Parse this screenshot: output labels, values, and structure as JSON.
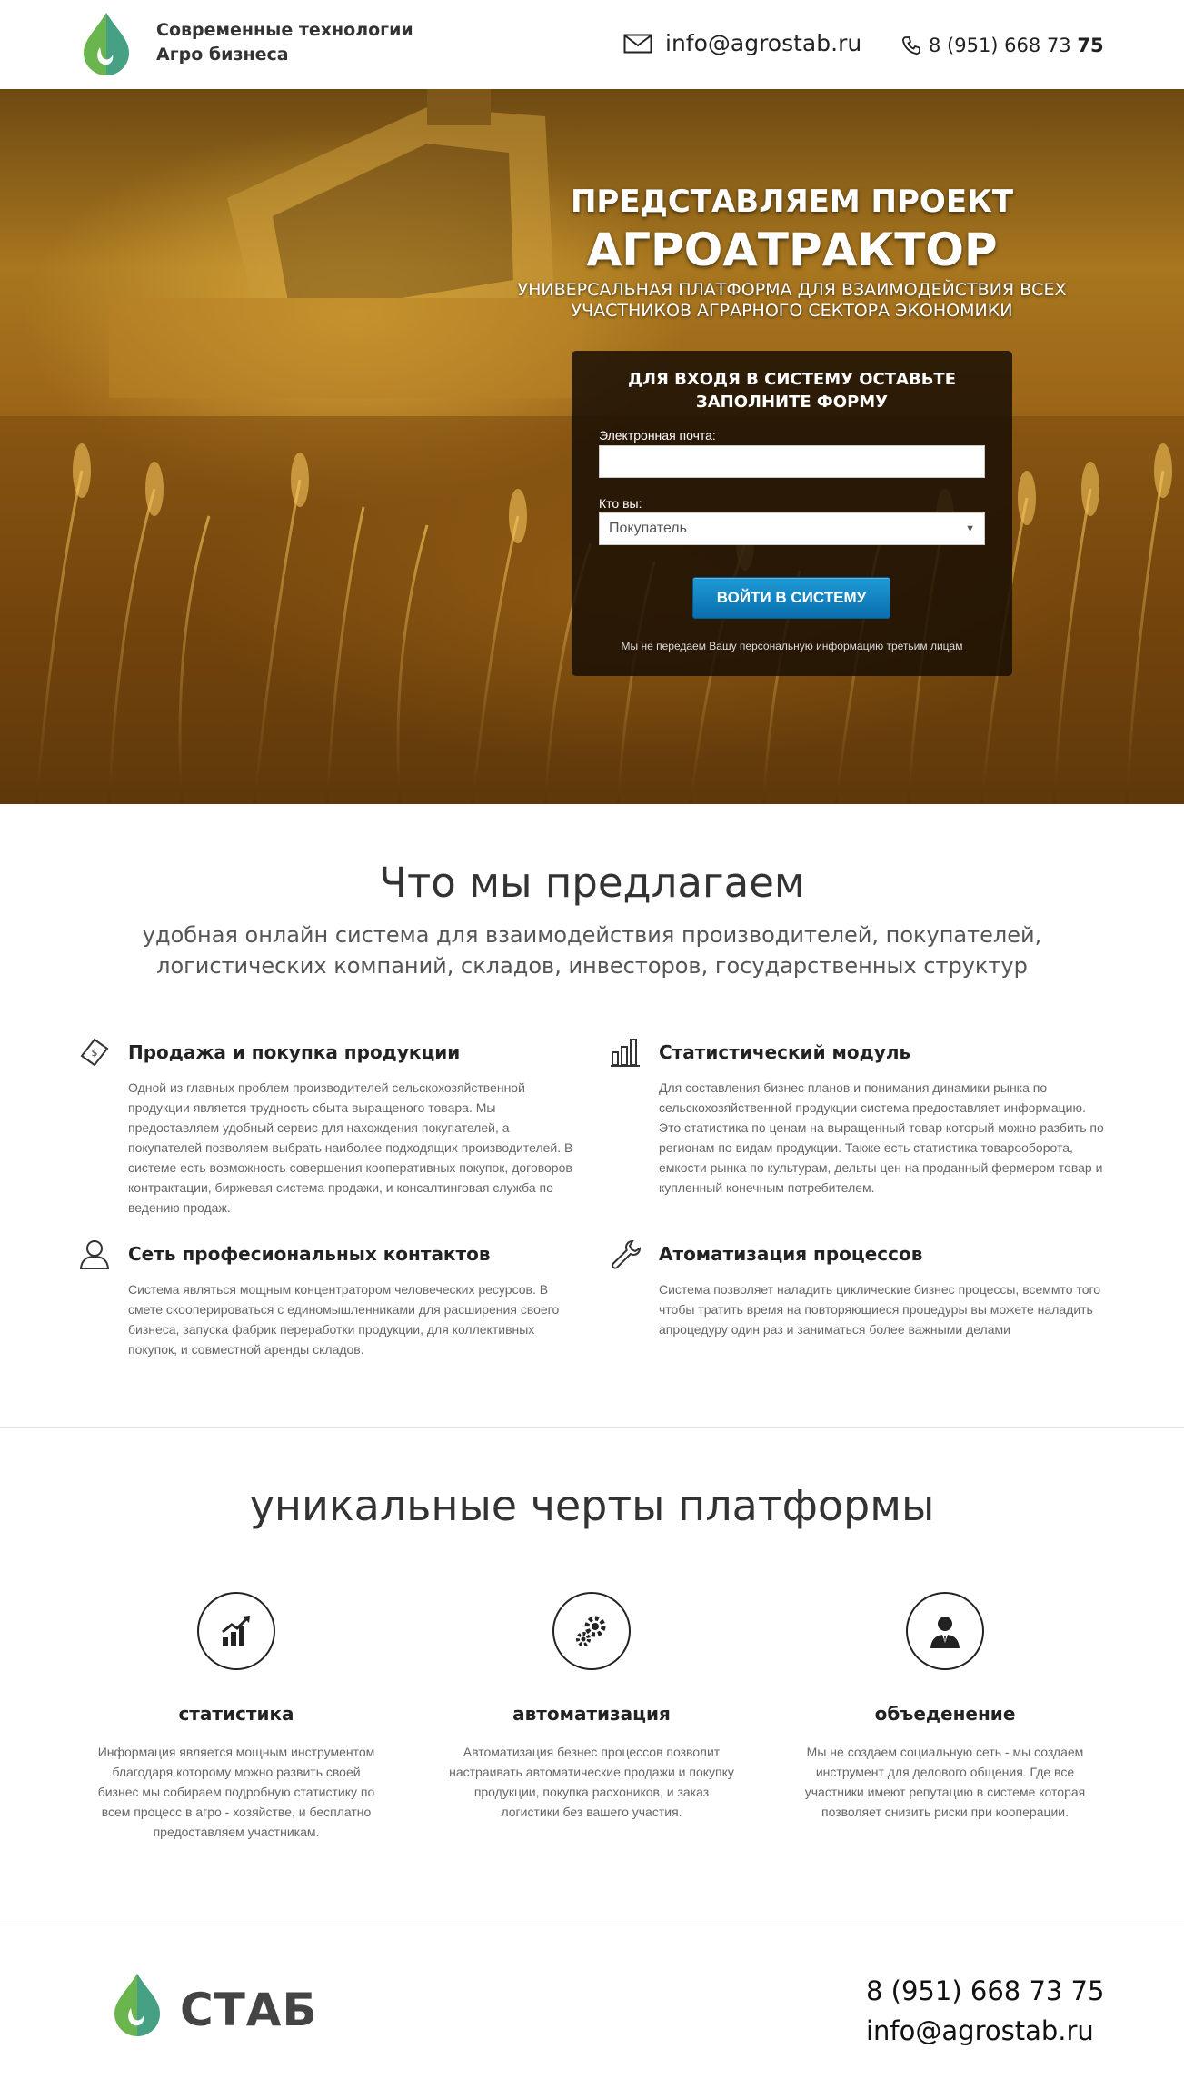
{
  "header": {
    "logo_line1": "Современные технологии",
    "logo_line2": "Агро бизнеса",
    "email": "info@agrostab.ru",
    "phone_main": "8 (951) 668 73 ",
    "phone_bold": "75",
    "icons": {
      "mail": "mail-icon",
      "phone": "phone-icon",
      "logo": "drop-logo-icon"
    }
  },
  "hero": {
    "title_line1": "ПРЕДСТАВЛЯЕМ ПРОЕКТ",
    "title_line2": "АГРОАТРАКТОР",
    "subtitle": "УНИВЕРСАЛЬНАЯ ПЛАТФОРМА ДЛЯ ВЗАИМОДЕЙСТВИЯ ВСЕХ УЧАСТНИКОВ АГРАРНОГО СЕКТОРА ЭКОНОМИКИ",
    "form": {
      "title_line1": "ДЛЯ ВХОДЯ В СИСТЕМУ ОСТАВЬТЕ",
      "title_line2": "ЗАПОЛНИТЕ ФОРМУ",
      "email_label": "Электронная почта:",
      "email_value": "",
      "role_label": "Кто вы:",
      "role_selected": "Покупатель",
      "submit_label": "ВОЙТИ В СИСТЕМУ",
      "privacy_note": "Мы не передаем Вашу персональную информацию третьим лицам"
    }
  },
  "offer": {
    "title": "Что мы предлагаем",
    "subtitle": "удобная онлайн система для взаимодействия производителей, покупателей, логистических компаний, складов, инвесторов, государственных структур",
    "features": [
      {
        "icon": "money-tag-icon",
        "title": "Продажа и покупка продукции",
        "text": "Одной из главных проблем производителей сельскохозяйственной продукции является трудность сбыта выращеного товара. Мы предоставляем удобный сервис для нахождения покупателей, а покупателей позволяем выбрать наиболее подходящих производителей. В системе есть возможность совершения кооперативных покупок, договоров контрактации, биржевая система продажи, и консалтинговая служба по ведению продаж."
      },
      {
        "icon": "bar-chart-icon",
        "title": "Статистический модуль",
        "text": "Для составления бизнес планов и понимания динамики рынка по сельскохозяйственной продукции система предоставляет информацию. Это статистика по ценам на выращенный товар который можно разбить по регионам по видам продукции. Также есть статистика товарооборота, емкости рынка по культурам, дельты цен на проданный фермером товар и купленный конечным потребителем."
      },
      {
        "icon": "person-icon",
        "title": "Сеть професиональных контактов",
        "text": "Система являться мощным концентратором человеческих ресурсов. В смете скооперироваться с единомышленниками для расширения своего бизнеса, запуска фабрик переработки продукции, для коллективных покупок, и совместной аренды складов."
      },
      {
        "icon": "wrench-icon",
        "title": "Атоматизация процессов",
        "text": "Система позволяет наладить циклические бизнес процессы, всеммто того чтобы тратить время на повторяющиеся процедуры вы можете наладить апроцедуру один раз и заниматься более важными делами"
      }
    ]
  },
  "unique": {
    "title": "уникальные черты платформы",
    "columns": [
      {
        "icon": "growth-chart-icon",
        "title": "статистика",
        "text": "Информация является мощным инструментом благодаря которому можно развить своей бизнес мы собираем подробную статистику по всем процесс в агро - хозяйстве, и бесплатно предоставляем участникам."
      },
      {
        "icon": "gears-icon",
        "title": "автоматизация",
        "text": "Автоматизация безнес процессов позволит настраивать автоматические продажи и покупку продукции, покупка расхоников, и заказ логистики без вашего участия."
      },
      {
        "icon": "businessman-icon",
        "title": "объеденение",
        "text": "Мы не создаем социальную сеть - мы создаем инструмент для делового общения. Где все участники имеют репутацию в системе которая позволяет снизить риски при кооперации."
      }
    ]
  },
  "footer": {
    "brand": "СТАБ",
    "phone": "8 (951) 668 73 75",
    "email": "info@agrostab.ru"
  },
  "colors": {
    "accent_blue": "#1e9ad6",
    "logo_green": "#5aa84a",
    "logo_teal": "#3d8f8a",
    "hero_gold": "#a8761f"
  }
}
